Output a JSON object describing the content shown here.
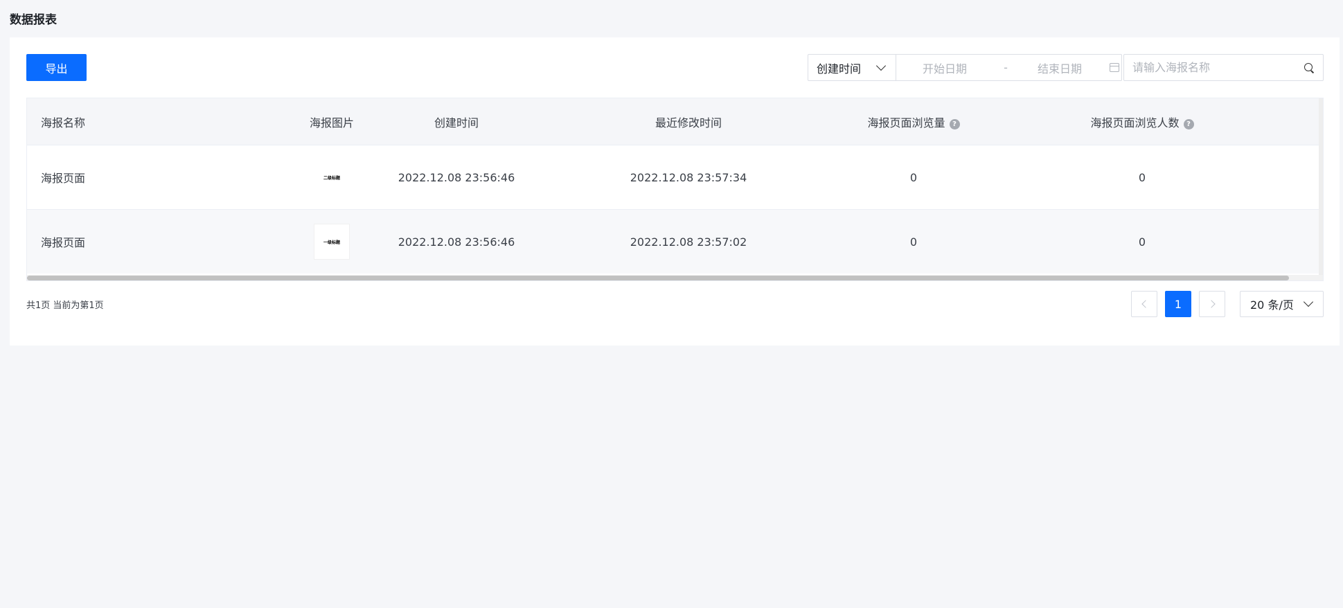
{
  "page": {
    "title": "数据报表"
  },
  "toolbar": {
    "export_label": "导出",
    "date_type": "创建时间",
    "start_placeholder": "开始日期",
    "separator": "-",
    "end_placeholder": "结束日期",
    "search_placeholder": "请输入海报名称"
  },
  "table": {
    "headers": {
      "name": "海报名称",
      "image": "海报图片",
      "created": "创建时间",
      "modified": "最近修改时间",
      "pv": "海报页面浏览量",
      "uv": "海报页面浏览人数"
    },
    "rows": [
      {
        "name": "海报页面",
        "thumb_text": "二级标题",
        "created": "2022.12.08 23:56:46",
        "modified": "2022.12.08 23:57:34",
        "pv": "0",
        "uv": "0"
      },
      {
        "name": "海报页面",
        "thumb_text": "一级标题",
        "created": "2022.12.08 23:56:46",
        "modified": "2022.12.08 23:57:02",
        "pv": "0",
        "uv": "0"
      }
    ]
  },
  "pagination": {
    "info": "共1页  当前为第1页",
    "current": "1",
    "page_size": "20 条/页"
  },
  "icons": {
    "help": "question-icon",
    "calendar": "calendar-icon",
    "search": "search-icon",
    "chevron": "chevron-down-icon"
  },
  "colors": {
    "primary": "#0a6cff",
    "background": "#f5f6f9"
  }
}
